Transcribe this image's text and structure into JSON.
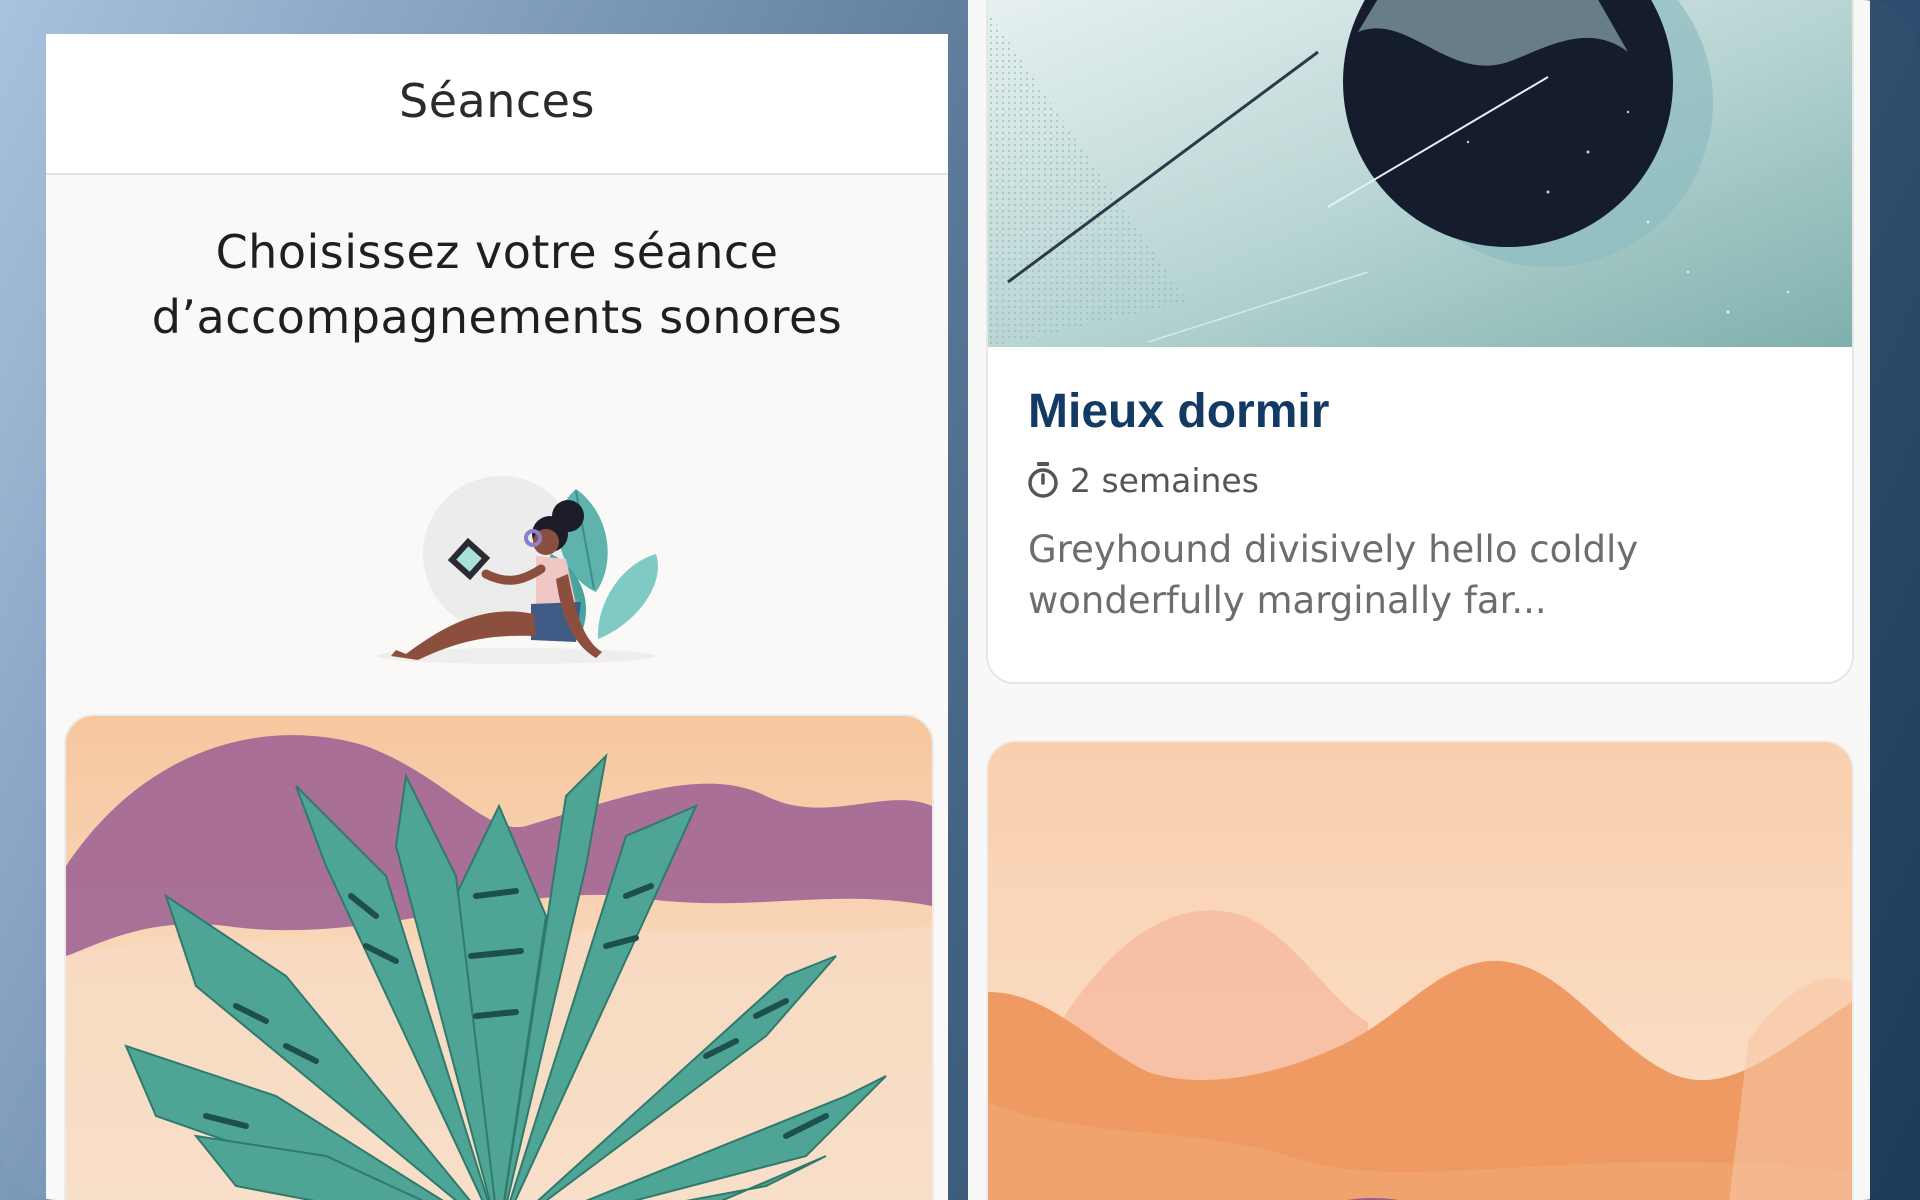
{
  "left_screen": {
    "nav_title": "Séances",
    "headline_line1": "Choisissez votre séance",
    "headline_line2": "d’accompagnements sonores",
    "illustration_icon": "woman-listening-headphones-illustration",
    "card_image": "aloe-plant-desert-artwork"
  },
  "right_screen": {
    "card": {
      "image": "moon-planet-artwork",
      "title": "Mieux dormir",
      "duration_icon": "stopwatch-icon",
      "duration": "2 semaines",
      "description_line1": "Greyhound divisively hello coldly",
      "description_line2": "wonderfully marginally far..."
    },
    "next_card_image": "orange-mountains-artwork"
  },
  "colors": {
    "title_blue": "#133a63",
    "background_gradient_start": "#a9c2df",
    "background_gradient_end": "#1d3a59"
  }
}
